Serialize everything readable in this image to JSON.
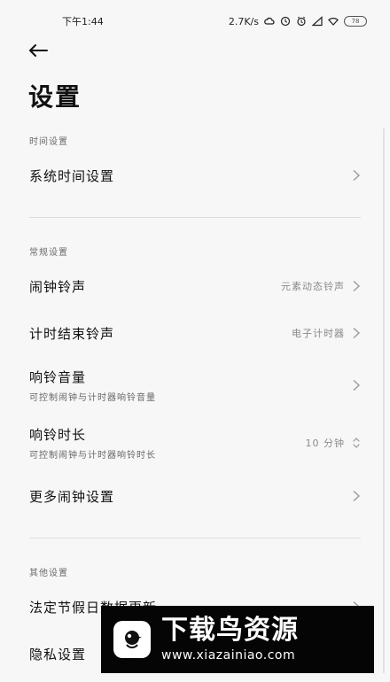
{
  "status_bar": {
    "time": "下午1:44",
    "speed": "2.7K/s",
    "battery": "78"
  },
  "header": {
    "title": "设置"
  },
  "sections": [
    {
      "title": "时间设置",
      "items": [
        {
          "label": "系统时间设置",
          "sublabel": "",
          "value": ""
        }
      ]
    },
    {
      "title": "常规设置",
      "items": [
        {
          "label": "闹钟铃声",
          "sublabel": "",
          "value": "元素动态铃声"
        },
        {
          "label": "计时结束铃声",
          "sublabel": "",
          "value": "电子计时器"
        },
        {
          "label": "响铃音量",
          "sublabel": "可控制闹钟与计时器响铃音量",
          "value": ""
        },
        {
          "label": "响铃时长",
          "sublabel": "可控制闹钟与计时器响铃时长",
          "value": "10 分钟"
        },
        {
          "label": "更多闹钟设置",
          "sublabel": "",
          "value": ""
        }
      ]
    },
    {
      "title": "其他设置",
      "items": [
        {
          "label": "法定节假日数据更新",
          "sublabel": "",
          "value": ""
        },
        {
          "label": "隐私设置",
          "sublabel": "",
          "value": ""
        }
      ]
    }
  ],
  "watermark": {
    "title": "下载鸟资源",
    "url": "www.xiazainiao.com"
  },
  "icons": {
    "back": "arrow-left-icon",
    "chevron": "chevron-right-icon",
    "expand": "unfold-icon"
  }
}
